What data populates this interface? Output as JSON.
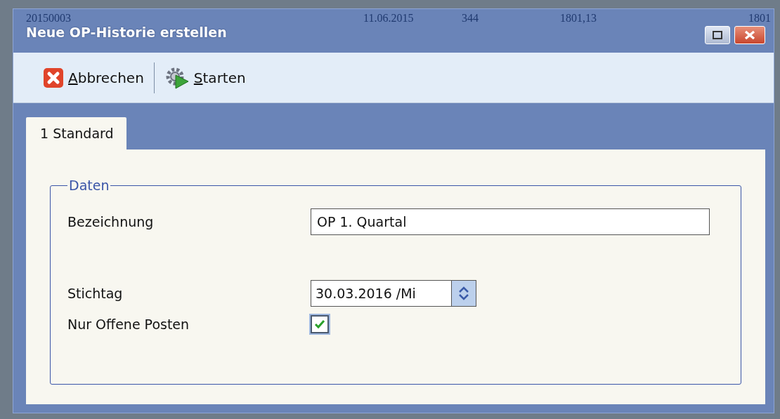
{
  "background_row": [
    "20150003",
    "11.06.2015",
    "344",
    "1801,13",
    "1801"
  ],
  "window": {
    "title": "Neue OP-Historie erstellen"
  },
  "toolbar": [
    {
      "kind": "cancel",
      "label": "Abbrechen"
    },
    {
      "kind": "start",
      "label": "Starten"
    }
  ],
  "tabs": [
    {
      "label": "1 Standard",
      "selected": true
    }
  ],
  "group": {
    "title": "Daten",
    "fields": [
      {
        "kind": "text",
        "label": "Bezeichnung",
        "value": "OP 1. Quartal"
      },
      {
        "kind": "date",
        "label": "Stichtag",
        "value": "30.03.2016 /Mi"
      },
      {
        "kind": "checkbox",
        "label": "Nur Offene Posten",
        "checked": true
      }
    ]
  }
}
